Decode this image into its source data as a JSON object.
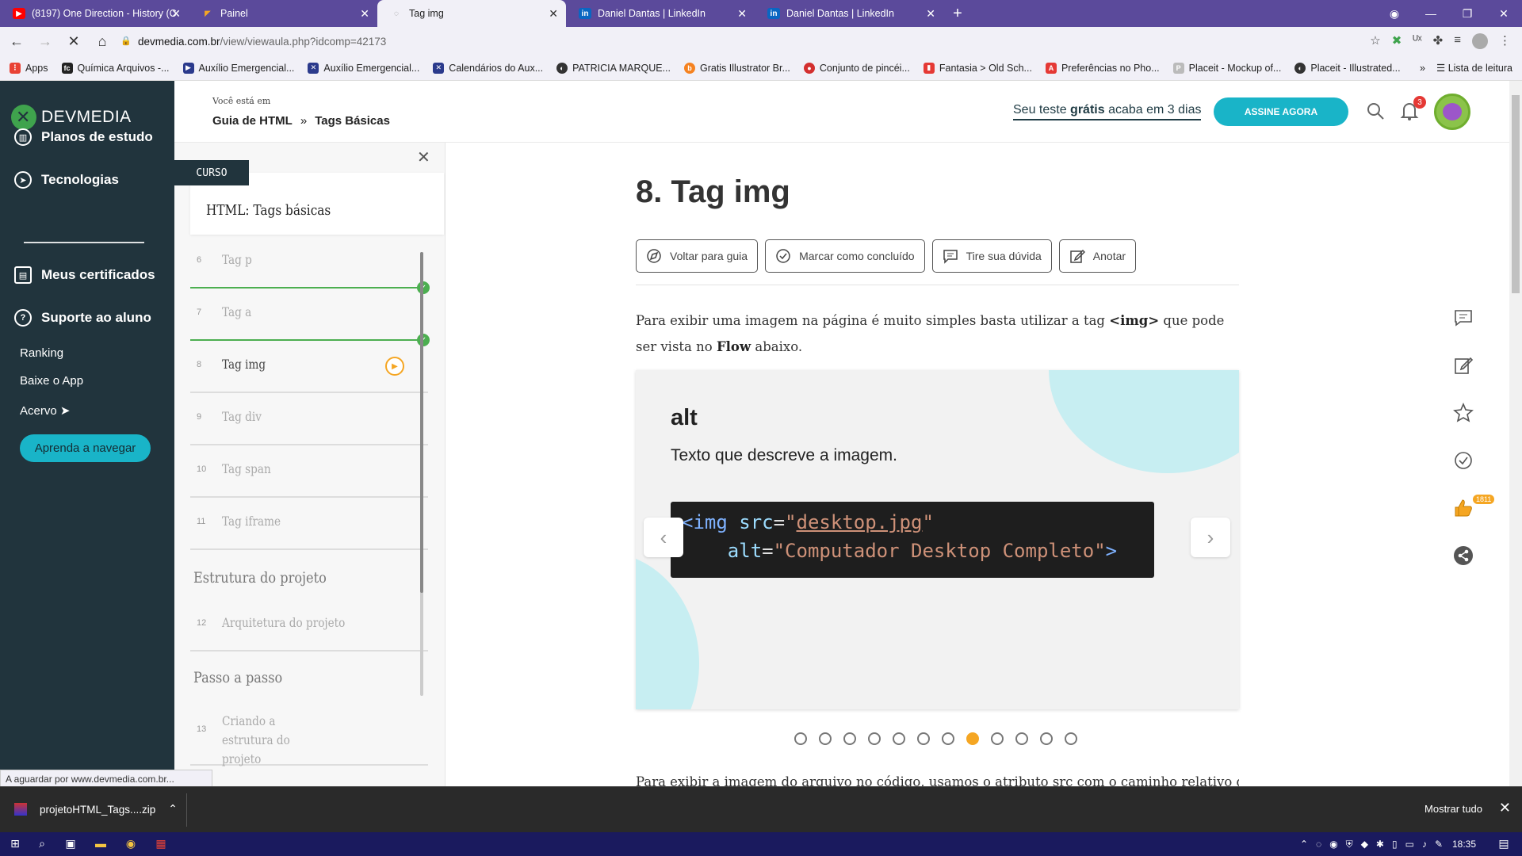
{
  "browser": {
    "tabs": [
      {
        "title": "(8197) One Direction - History (C",
        "fav": "▶",
        "fav_color": "#ff0000"
      },
      {
        "title": "Painel",
        "fav": "◤",
        "fav_color": "#f5a623"
      },
      {
        "title": "Tag img",
        "fav": "◌",
        "fav_color": "#888888"
      },
      {
        "title": "Daniel Dantas | LinkedIn",
        "fav": "in",
        "fav_color": "#0a66c2"
      },
      {
        "title": "Daniel Dantas | LinkedIn",
        "fav": "in",
        "fav_color": "#0a66c2"
      }
    ],
    "url_domain": "devmedia.com.br",
    "url_path": "/view/viewaula.php?idcomp=42173",
    "bookmarks": [
      {
        "label": "Apps",
        "color": "#e94235"
      },
      {
        "label": "Química Arquivos -...",
        "color": "#222222"
      },
      {
        "label": "Auxílio Emergencial...",
        "color": "#2b3a8c"
      },
      {
        "label": "Auxílio Emergencial...",
        "color": "#2b3a8c"
      },
      {
        "label": "Calendários do Aux...",
        "color": "#2b3a8c"
      },
      {
        "label": "PATRICIA MARQUE...",
        "color": "#333333"
      },
      {
        "label": "Gratis Illustrator Br...",
        "color": "#f58220"
      },
      {
        "label": "Conjunto de pincéi...",
        "color": "#d32f2f"
      },
      {
        "label": "Fantasia > Old Sch...",
        "color": "#e53935"
      },
      {
        "label": "Preferências no Pho...",
        "color": "#e53935"
      },
      {
        "label": "Placeit - Mockup of...",
        "color": "#bbbbbb"
      },
      {
        "label": "Placeit - Illustrated...",
        "color": "#333333"
      }
    ],
    "reading_list": "Lista de leitura",
    "more": "»",
    "status": "A aguardar por www.devmedia.com.br..."
  },
  "leftnav": {
    "logo_text": "DEVMEDIA",
    "main_items": [
      {
        "label": "Planos de estudo",
        "icon": "chart-icon"
      },
      {
        "label": "Tecnologias",
        "icon": "compass-icon"
      },
      {
        "label": "Meus certificados",
        "icon": "certificate-icon"
      },
      {
        "label": "Suporte ao aluno",
        "icon": "help-icon"
      }
    ],
    "sub_items": [
      "Ranking",
      "Baixe o App",
      "Acervo ➤"
    ],
    "learn_button": "Aprenda a navegar"
  },
  "header": {
    "crumb_label": "Você está em",
    "crumb_parent": "Guia de HTML",
    "crumb_sep": "»",
    "crumb_current": "Tags Básicas",
    "trial_pre": "Seu teste ",
    "trial_bold": "grátis",
    "trial_post": " acaba em 3 dias",
    "subscribe": "ASSINE AGORA",
    "notif_count": "3"
  },
  "course": {
    "tag": "CURSO",
    "name": "HTML: Tags básicas",
    "lessons": [
      {
        "num": "6",
        "title": "Tag p"
      },
      {
        "num": "7",
        "title": "Tag a"
      },
      {
        "num": "8",
        "title": "Tag img"
      },
      {
        "num": "9",
        "title": "Tag div"
      },
      {
        "num": "10",
        "title": "Tag span"
      },
      {
        "num": "11",
        "title": "Tag iframe"
      }
    ],
    "section1": "Estrutura do projeto",
    "lesson12": {
      "num": "12",
      "title": "Arquitetura do projeto"
    },
    "section2": "Passo a passo",
    "lesson13": {
      "num": "13",
      "title": "Criando a estrutura do projeto"
    }
  },
  "main": {
    "title": "8. Tag img",
    "actions": [
      "Voltar para guia",
      "Marcar como concluído",
      "Tire sua dúvida",
      "Anotar"
    ],
    "para_1": "Para exibir uma imagem na página é muito simples basta utilizar a tag ",
    "para_tag": "<img>",
    "para_2": " que pode ser vista no ",
    "para_flow": "Flow",
    "para_3": " abaixo.",
    "slide_title": "alt",
    "slide_desc": "Texto que descreve a imagem.",
    "code_line1_tag": "<img ",
    "code_line1_attr": "src",
    "code_line1_eq": "=",
    "code_line1_q1": "\"",
    "code_line1_val": "desktop.jpg",
    "code_line1_q2": "\"",
    "code_line2_attr": "    alt",
    "code_line2_eq": "=",
    "code_line2_val": "\"Computador Desktop Completo\"",
    "code_line2_end": ">",
    "dots_total": 12,
    "dots_active": 8,
    "para2": "Para exibir a imagem do arquivo no código, usamos o atributo src com o caminho relativo da imagem a partir"
  },
  "rail": {
    "likes": "1811"
  },
  "downloads": {
    "file": "projetoHTML_Tags....zip",
    "show_all": "Mostrar tudo"
  },
  "taskbar": {
    "time": "18:35"
  }
}
